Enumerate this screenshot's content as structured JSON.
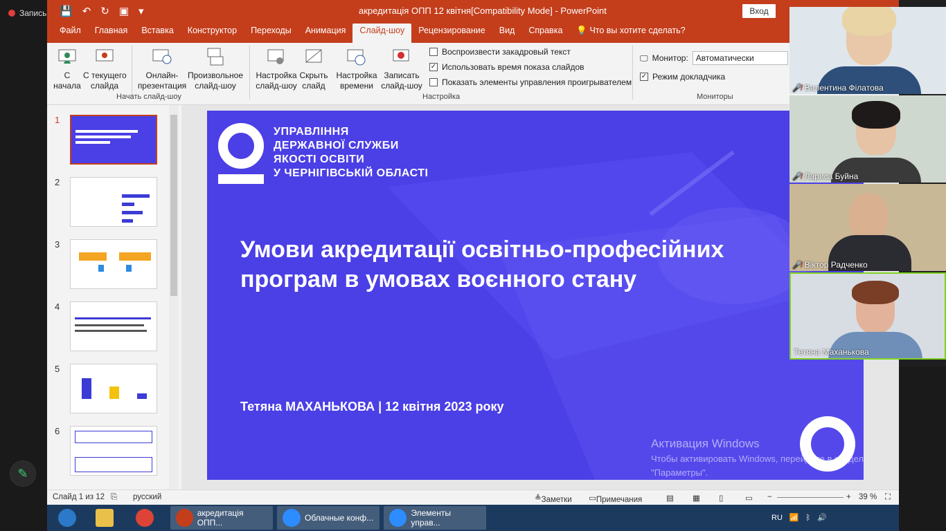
{
  "zoom": {
    "record_label": "Запись",
    "annotate_icon": "pencil-icon"
  },
  "ppt": {
    "window_title": "акредитація ОПП 12 квітня[Compatibility Mode]  -  PowerPoint",
    "signin_label": "Вход",
    "tabs": [
      "Файл",
      "Главная",
      "Вставка",
      "Конструктор",
      "Переходы",
      "Анимация",
      "Слайд-шоу",
      "Рецензирование",
      "Вид",
      "Справка",
      "Что вы хотите сделать?"
    ],
    "ribbon": {
      "from_start": "С\nначала",
      "from_current": "С текущего\nслайда",
      "online": "Онлайн-\nпрезентация",
      "custom": "Произвольное\nслайд-шоу",
      "group_start": "Начать слайд-шоу",
      "setup": "Настройка\nслайд-шоу",
      "hide": "Скрыть\nслайд",
      "rehearse": "Настройка\nвремени",
      "record": "Записать\nслайд-шоу",
      "chk_narration": "Воспроизвести закадровый текст",
      "chk_timings": "Использовать время показа слайдов",
      "chk_controls": "Показать элементы управления проигрывателем",
      "group_setup": "Настройка",
      "monitor_label": "Монитор:",
      "monitor_value": "Автоматически",
      "presenter_view": "Режим докладчика",
      "group_monitors": "Мониторы"
    },
    "thumbnails": [
      "1",
      "2",
      "3",
      "4",
      "5",
      "6"
    ],
    "slide": {
      "org_lines": [
        "УПРАВЛІННЯ",
        "ДЕРЖАВНОЇ СЛУЖБИ",
        "ЯКОСТІ ОСВІТИ",
        "У ЧЕРНІГІВСЬКІЙ ОБЛАСТІ"
      ],
      "title": "Умови акредитації освітньо-професійних програм в умовах воєнного стану",
      "author": "Тетяна МАХАНЬКОВА  |  12 квітня 2023 року"
    },
    "watermark": {
      "line1": "Активация Windows",
      "line2": "Чтобы активировать Windows, перейдите в раздел \"Параметры\"."
    },
    "status": {
      "slide_counter": "Слайд 1 из 12",
      "language": "русский",
      "notes": "Заметки",
      "comments": "Примечания",
      "zoom": "39 %"
    }
  },
  "participants": [
    {
      "name": "Валентина Філатова",
      "muted": true
    },
    {
      "name": "Лариса Буйна",
      "muted": true
    },
    {
      "name": "Віктор Радченко",
      "muted": true
    },
    {
      "name": "Тетяна Маханькова",
      "muted": false
    }
  ],
  "taskbar": {
    "items": [
      "акредитація ОПП...",
      "Облачные конф...",
      "Элементы управ..."
    ],
    "tray_lang": "RU"
  }
}
